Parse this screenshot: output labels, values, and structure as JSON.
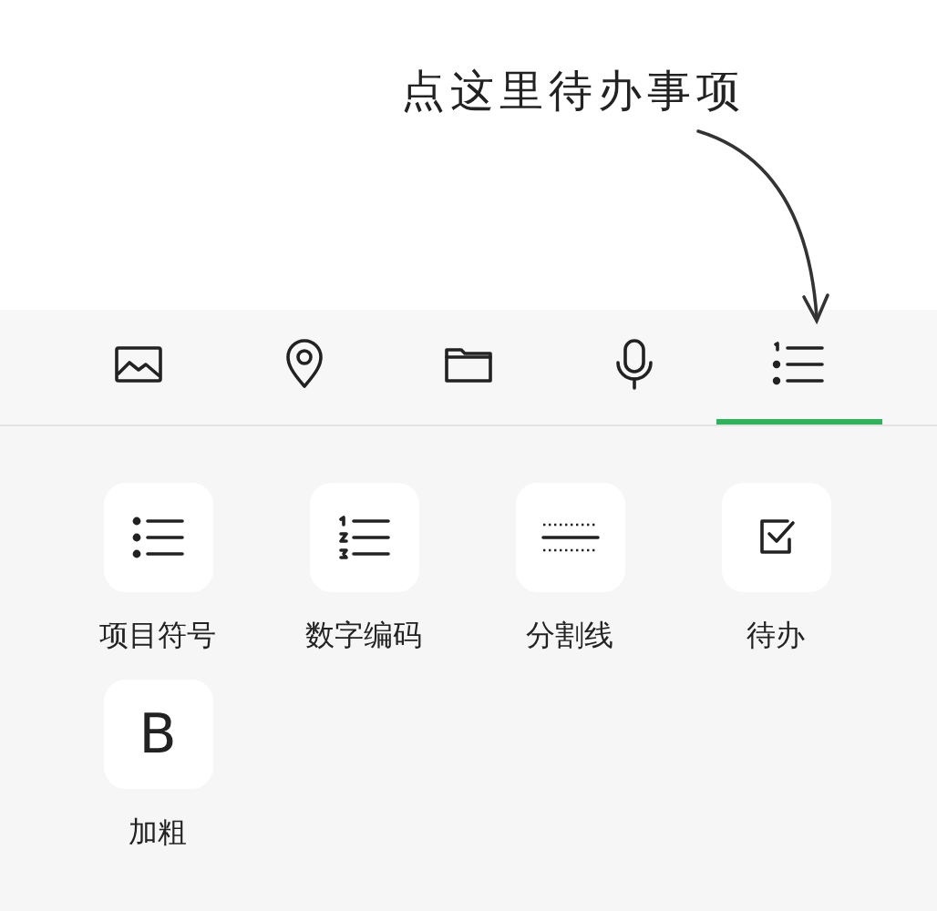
{
  "annotation": {
    "text": "点这里待办事项"
  },
  "tabs": [
    {
      "kind": "image",
      "selected": false
    },
    {
      "kind": "location",
      "selected": false
    },
    {
      "kind": "folder",
      "selected": false
    },
    {
      "kind": "microphone",
      "selected": false
    },
    {
      "kind": "list",
      "selected": true
    }
  ],
  "tools": [
    {
      "kind": "bullets",
      "label": "项目符号"
    },
    {
      "kind": "numbered",
      "label": "数字编码"
    },
    {
      "kind": "divider",
      "label": "分割线"
    },
    {
      "kind": "todo",
      "label": "待办"
    },
    {
      "kind": "bold",
      "glyph": "B",
      "label": "加粗"
    }
  ]
}
